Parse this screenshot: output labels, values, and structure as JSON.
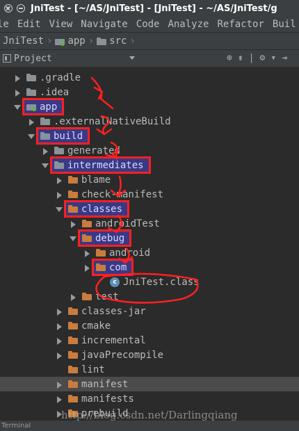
{
  "window": {
    "title": "JniTest - [~/AS/JniTest] - [JniTest] - ~/AS/JniTest/g"
  },
  "menu": {
    "items": [
      "le",
      "Edit",
      "View",
      "Navigate",
      "Code",
      "Analyze",
      "Refactor",
      "Buil"
    ]
  },
  "breadcrumb": {
    "project": "JniTest",
    "module": "app",
    "folder": "src"
  },
  "panel": {
    "title": "Project"
  },
  "tree": [
    {
      "label": ".gradle",
      "arrow": "right",
      "icon": "folder-grey",
      "highlight": false
    },
    {
      "label": ".idea",
      "arrow": "right",
      "icon": "folder-grey",
      "highlight": false
    },
    {
      "label": "app",
      "arrow": "down",
      "icon": "module-folder",
      "highlight": true
    },
    {
      "label": ".externalNativeBuild",
      "arrow": "right",
      "icon": "folder-grey",
      "highlight": false
    },
    {
      "label": "build",
      "arrow": "down",
      "icon": "folder-blue",
      "highlight": true
    },
    {
      "label": "generated",
      "arrow": "right",
      "icon": "folder-grey",
      "highlight": false
    },
    {
      "label": "intermediates",
      "arrow": "down",
      "icon": "folder-blue",
      "highlight": true
    },
    {
      "label": "blame",
      "arrow": "right",
      "icon": "folder-orange",
      "highlight": false
    },
    {
      "label": "check-manifest",
      "arrow": "right",
      "icon": "folder-orange",
      "highlight": false
    },
    {
      "label": "classes",
      "arrow": "down",
      "icon": "folder-orange",
      "highlight": true
    },
    {
      "label": "androidTest",
      "arrow": "right",
      "icon": "folder-orange",
      "highlight": false
    },
    {
      "label": "debug",
      "arrow": "down",
      "icon": "folder-orange",
      "highlight": true
    },
    {
      "label": "android",
      "arrow": "right",
      "icon": "folder-orange",
      "highlight": false
    },
    {
      "label": "com",
      "arrow": "right",
      "icon": "folder-orange",
      "highlight": true
    },
    {
      "label": "JniTest.class",
      "arrow": "none",
      "icon": "class-file",
      "highlight": false
    },
    {
      "label": "test",
      "arrow": "right",
      "icon": "folder-orange",
      "highlight": false
    },
    {
      "label": "classes-jar",
      "arrow": "right",
      "icon": "folder-orange",
      "highlight": false
    },
    {
      "label": "cmake",
      "arrow": "right",
      "icon": "folder-orange",
      "highlight": false
    },
    {
      "label": "incremental",
      "arrow": "right",
      "icon": "folder-orange",
      "highlight": false
    },
    {
      "label": "javaPrecompile",
      "arrow": "right",
      "icon": "folder-orange",
      "highlight": false
    },
    {
      "label": "lint",
      "arrow": "none",
      "icon": "folder-orange",
      "highlight": false
    },
    {
      "label": "manifest",
      "arrow": "right",
      "icon": "folder-orange",
      "highlight": false
    },
    {
      "label": "manifests",
      "arrow": "right",
      "icon": "folder-orange",
      "highlight": false
    },
    {
      "label": "prebuild",
      "arrow": "right",
      "icon": "folder-orange",
      "highlight": false
    }
  ],
  "watermark": "http://blog.csdn.net/Darlingqiang",
  "status": {
    "text": "Terminal"
  },
  "colors": {
    "annotation": "#ff2020",
    "highlight_fill": "#3a3a8c",
    "background": "#2b2b2b"
  }
}
